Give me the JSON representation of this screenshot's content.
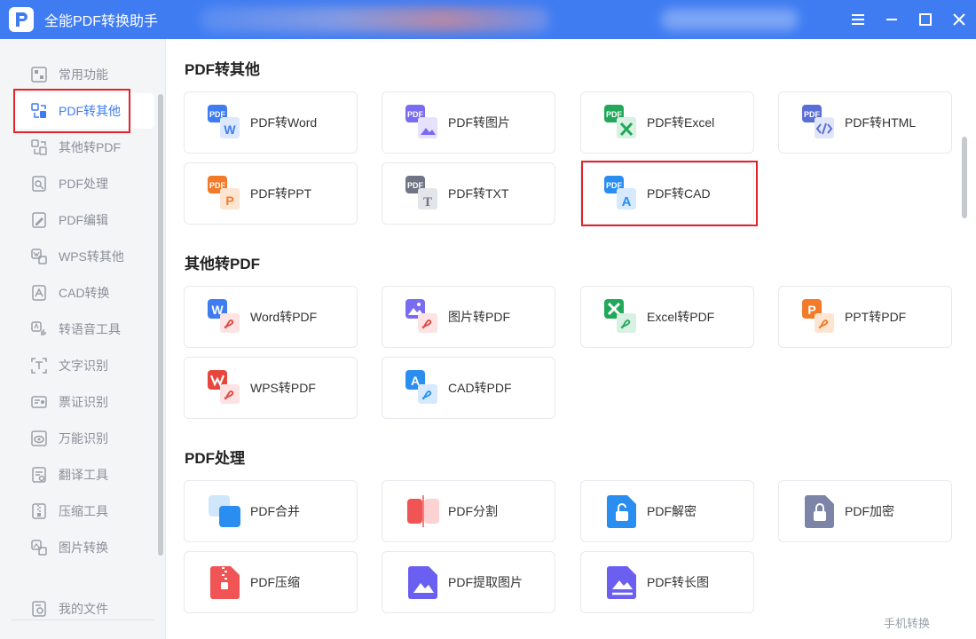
{
  "app": {
    "title": "全能PDF转换助手"
  },
  "sidebar": {
    "items": [
      {
        "label": "常用功能",
        "icon": "home-grid-icon"
      },
      {
        "label": "PDF转其他",
        "icon": "pdf-convert-icon",
        "active": true
      },
      {
        "label": "其他转PDF",
        "icon": "to-pdf-icon"
      },
      {
        "label": "PDF处理",
        "icon": "pdf-process-icon"
      },
      {
        "label": "PDF编辑",
        "icon": "pdf-edit-icon"
      },
      {
        "label": "WPS转其他",
        "icon": "wps-convert-icon"
      },
      {
        "label": "CAD转换",
        "icon": "cad-convert-icon"
      },
      {
        "label": "转语音工具",
        "icon": "speech-icon"
      },
      {
        "label": "文字识别",
        "icon": "ocr-icon"
      },
      {
        "label": "票证识别",
        "icon": "ticket-icon"
      },
      {
        "label": "万能识别",
        "icon": "eye-scan-icon"
      },
      {
        "label": "翻译工具",
        "icon": "translate-icon"
      },
      {
        "label": "压缩工具",
        "icon": "zip-icon"
      },
      {
        "label": "图片转换",
        "icon": "image-convert-icon"
      }
    ],
    "my_files": "我的文件"
  },
  "sections": {
    "pdf_to_other": {
      "title": "PDF转其他",
      "cards": [
        {
          "label": "PDF转Word",
          "icon": "pdf-to-word-icon"
        },
        {
          "label": "PDF转图片",
          "icon": "pdf-to-image-icon"
        },
        {
          "label": "PDF转Excel",
          "icon": "pdf-to-excel-icon"
        },
        {
          "label": "PDF转HTML",
          "icon": "pdf-to-html-icon"
        },
        {
          "label": "PDF转PPT",
          "icon": "pdf-to-ppt-icon"
        },
        {
          "label": "PDF转TXT",
          "icon": "pdf-to-txt-icon"
        },
        {
          "label": "PDF转CAD",
          "icon": "pdf-to-cad-icon"
        }
      ]
    },
    "other_to_pdf": {
      "title": "其他转PDF",
      "cards": [
        {
          "label": "Word转PDF",
          "icon": "word-to-pdf-icon"
        },
        {
          "label": "图片转PDF",
          "icon": "image-to-pdf-icon"
        },
        {
          "label": "Excel转PDF",
          "icon": "excel-to-pdf-icon"
        },
        {
          "label": "PPT转PDF",
          "icon": "ppt-to-pdf-icon"
        },
        {
          "label": "WPS转PDF",
          "icon": "wps-to-pdf-icon"
        },
        {
          "label": "CAD转PDF",
          "icon": "cad-to-pdf-icon"
        }
      ]
    },
    "pdf_process": {
      "title": "PDF处理",
      "cards": [
        {
          "label": "PDF合并",
          "icon": "merge-icon"
        },
        {
          "label": "PDF分割",
          "icon": "split-icon"
        },
        {
          "label": "PDF解密",
          "icon": "unlock-icon"
        },
        {
          "label": "PDF加密",
          "icon": "lock-icon"
        },
        {
          "label": "PDF压缩",
          "icon": "compress-icon"
        },
        {
          "label": "PDF提取图片",
          "icon": "extract-image-icon"
        },
        {
          "label": "PDF转长图",
          "icon": "long-image-icon"
        }
      ]
    }
  },
  "footer": {
    "mobile_convert": "手机转换"
  },
  "colors": {
    "accent": "#3f7cf2",
    "highlight": "#e0242a",
    "sidebar_bg": "#f4f5f7"
  }
}
